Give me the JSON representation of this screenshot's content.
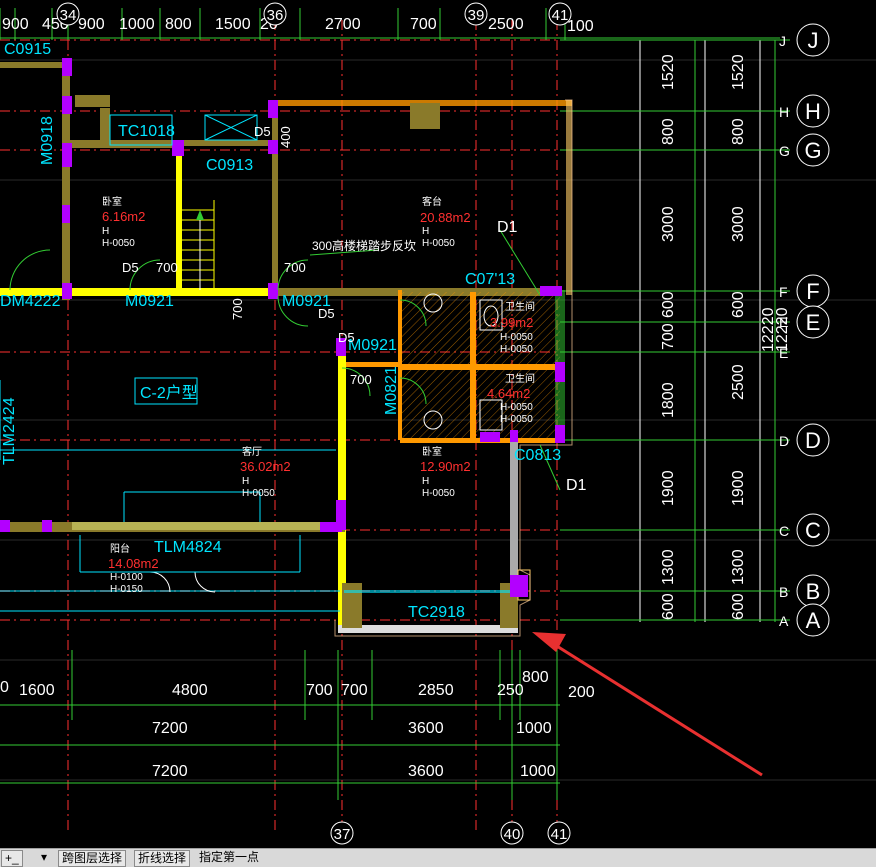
{
  "canvas": {
    "background": "#000000",
    "grid_bubbles_top": [
      "34",
      "36",
      "39",
      "41"
    ],
    "grid_bubbles_bottom": [
      "37",
      "40",
      "41"
    ],
    "grid_bubbles_right": [
      "J",
      "H",
      "G",
      "F",
      "E",
      "D",
      "C",
      "B",
      "A"
    ],
    "grid_letters_small": [
      "J",
      "H",
      "G",
      "F",
      "E",
      "E",
      "D",
      "C",
      "B",
      "A"
    ],
    "top_dims": [
      "900",
      "450",
      "900",
      "1000",
      "800",
      "1500",
      "2700",
      "700",
      "2500",
      "100"
    ],
    "top_dim_partial": "20",
    "right_dims_inner": [
      "1520",
      "800",
      "3000",
      "700",
      "600",
      "1800",
      "1900",
      "1300",
      "600"
    ],
    "right_dims_outer": [
      "1520",
      "800",
      "3000",
      "600",
      "2500",
      "1900",
      "1300",
      "600"
    ],
    "right_total_inner": "12220",
    "right_total_outer": "12220",
    "bottom_dims_row1": [
      "0",
      "1600",
      "4800",
      "700",
      "700",
      "2850",
      "250",
      "800",
      "200"
    ],
    "bottom_dims_row2": [
      "7200",
      "3600",
      "1000"
    ],
    "bottom_dims_row3": [
      "7200",
      "3600",
      "1000"
    ],
    "labels": {
      "c0915": "C0915",
      "m0918": "M0918",
      "tc1018": "TC1018",
      "c0913": "C0913",
      "d5_a": "D5",
      "dim_400": "400",
      "d5_b": "D5",
      "dim_700_a": "700",
      "dm4222": "DM4222",
      "m0921_a": "M0921",
      "m0921_b": "M0921",
      "dim_700_b": "700",
      "dim_700_c": "700",
      "d5_c": "D5",
      "d1_a": "D1",
      "c0713": "C07'13",
      "d5_d": "D5",
      "m0921_c": "M0921",
      "m0821": "M0821",
      "dim_700_d": "700",
      "c2_unit": "C-2户型",
      "tlm2424": "TLM2424",
      "tlm4824": "TLM4824",
      "tc2918": "TC2918",
      "c0813": "C0813",
      "d1_b": "D1",
      "note_300": "300高楼梯踏步反坎"
    },
    "rooms": [
      {
        "name": "卧室",
        "area": "6.16m2",
        "h": "H",
        "elev": "H-0050"
      },
      {
        "name": "客台",
        "area": "20.88m2",
        "h": "H",
        "elev": "H-0050"
      },
      {
        "name": "卫生间",
        "area": "3.99m2",
        "h": "H-0050",
        "elev": "H-0050"
      },
      {
        "name": "卫生间",
        "area": "4.64m2",
        "h": "H-0050",
        "elev": "H-0050"
      },
      {
        "name": "客厅",
        "area": "36.02m2",
        "h": "H",
        "elev": "H-0050"
      },
      {
        "name": "卧室",
        "area": "12.90m2",
        "h": "H",
        "elev": "H-0050"
      },
      {
        "name": "阳台",
        "area": "14.08m2",
        "h": "H-0100",
        "elev": "H-0150"
      }
    ],
    "colors": {
      "wall_olive": "#8a7a2a",
      "wall_yellow": "#ffff00",
      "wall_orange": "#ff9900",
      "column_magenta": "#b300ff",
      "axis_red": "#ff3030",
      "dim_green": "#33cc33",
      "dim_white": "#ffffff",
      "cyan": "#00e5ff",
      "grid_line": "#3a3a3a",
      "arrow_red": "#e83030"
    }
  },
  "statusbar": {
    "items": [
      "+_",
      "▾",
      "跨图层选择",
      "折线选择",
      "指定第一点"
    ]
  }
}
